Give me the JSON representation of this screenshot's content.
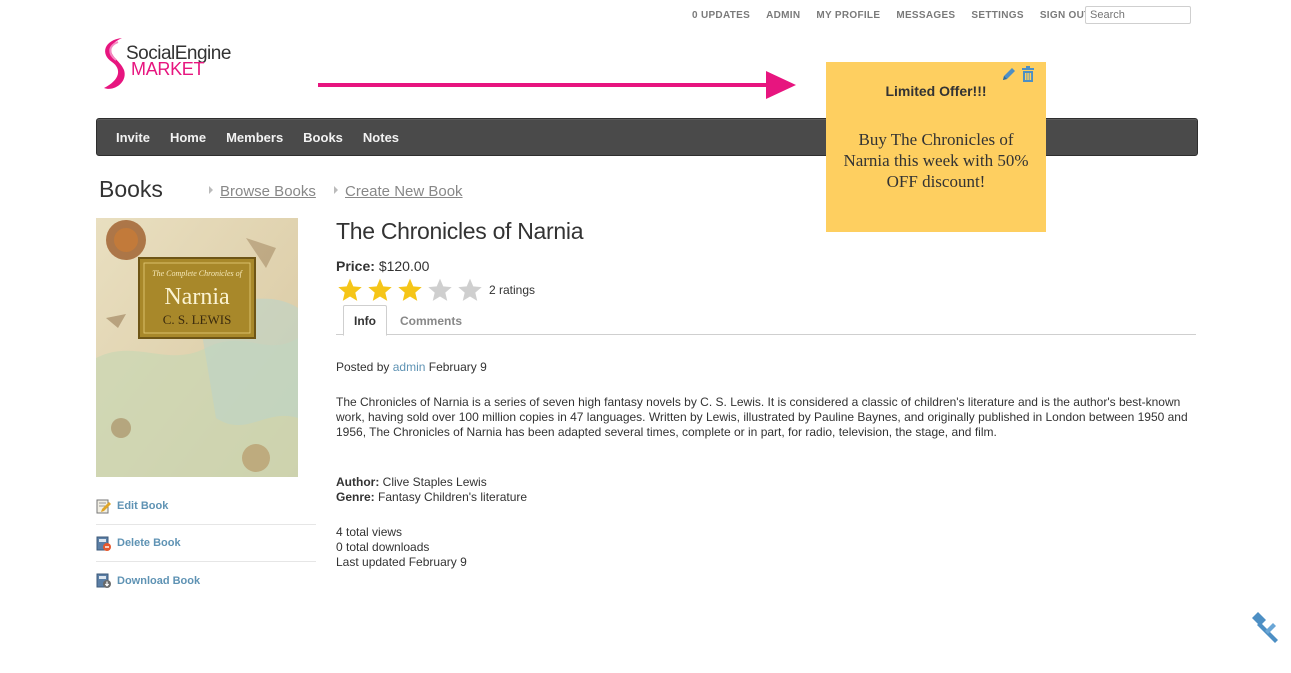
{
  "top_menu": {
    "items": [
      "0 UPDATES",
      "ADMIN",
      "MY PROFILE",
      "MESSAGES",
      "SETTINGS",
      "SIGN OUT"
    ],
    "search_placeholder": "Search"
  },
  "logo": {
    "line1": "SocialEngine",
    "line2": "MARKET"
  },
  "offer": {
    "title": "Limited Offer!!!",
    "text": "Buy The Chronicles of Narnia this week with 50% OFF discount!"
  },
  "main_nav": {
    "items": [
      "Invite",
      "Home",
      "Members",
      "Books",
      "Notes"
    ]
  },
  "page": {
    "title": "Books",
    "subnav": [
      "Browse Books",
      "Create New Book"
    ]
  },
  "cover": {
    "subtitle": "The Complete Chronicles of",
    "title": "Narnia",
    "author": "C. S. LEWIS"
  },
  "side_links": [
    "Edit Book",
    "Delete Book",
    "Download Book"
  ],
  "book": {
    "title": "The Chronicles of Narnia",
    "price_label": "Price:",
    "price_value": "$120.00",
    "rating_filled": 3,
    "rating_max": 5,
    "rating_count": "2 ratings",
    "tabs": [
      "Info",
      "Comments"
    ],
    "posted_by_prefix": "Posted by",
    "posted_by_user": "admin",
    "posted_date": "February 9",
    "description": "The Chronicles of Narnia is a series of seven high fantasy novels by C. S. Lewis. It is considered a classic of children's literature and is the author's best-known work, having sold over 100 million copies in 47 languages. Written by Lewis, illustrated by Pauline Baynes, and originally published in London between 1950 and 1956, The Chronicles of Narnia has been adapted several times, complete or in part, for radio, television, the stage, and film.",
    "author_label": "Author:",
    "author_value": "Clive Staples Lewis",
    "genre_label": "Genre:",
    "genre_value": "Fantasy Children's literature",
    "views": "4 total views",
    "downloads": "0 total downloads",
    "updated": "Last updated February 9"
  },
  "colors": {
    "accent_pink": "#e7157f",
    "offer_bg": "#fecf60",
    "nav_bg": "#4a4a4a",
    "link_blue": "#5f93b4",
    "star_gold": "#f5c518",
    "star_gray": "#cfcfcf"
  },
  "icons": {
    "offer_edit": "pencil-icon",
    "offer_delete": "trash-icon",
    "edit_book": "edit-book-icon",
    "delete_book": "delete-book-icon",
    "download_book": "download-book-icon",
    "corner": "hammer-icon"
  }
}
